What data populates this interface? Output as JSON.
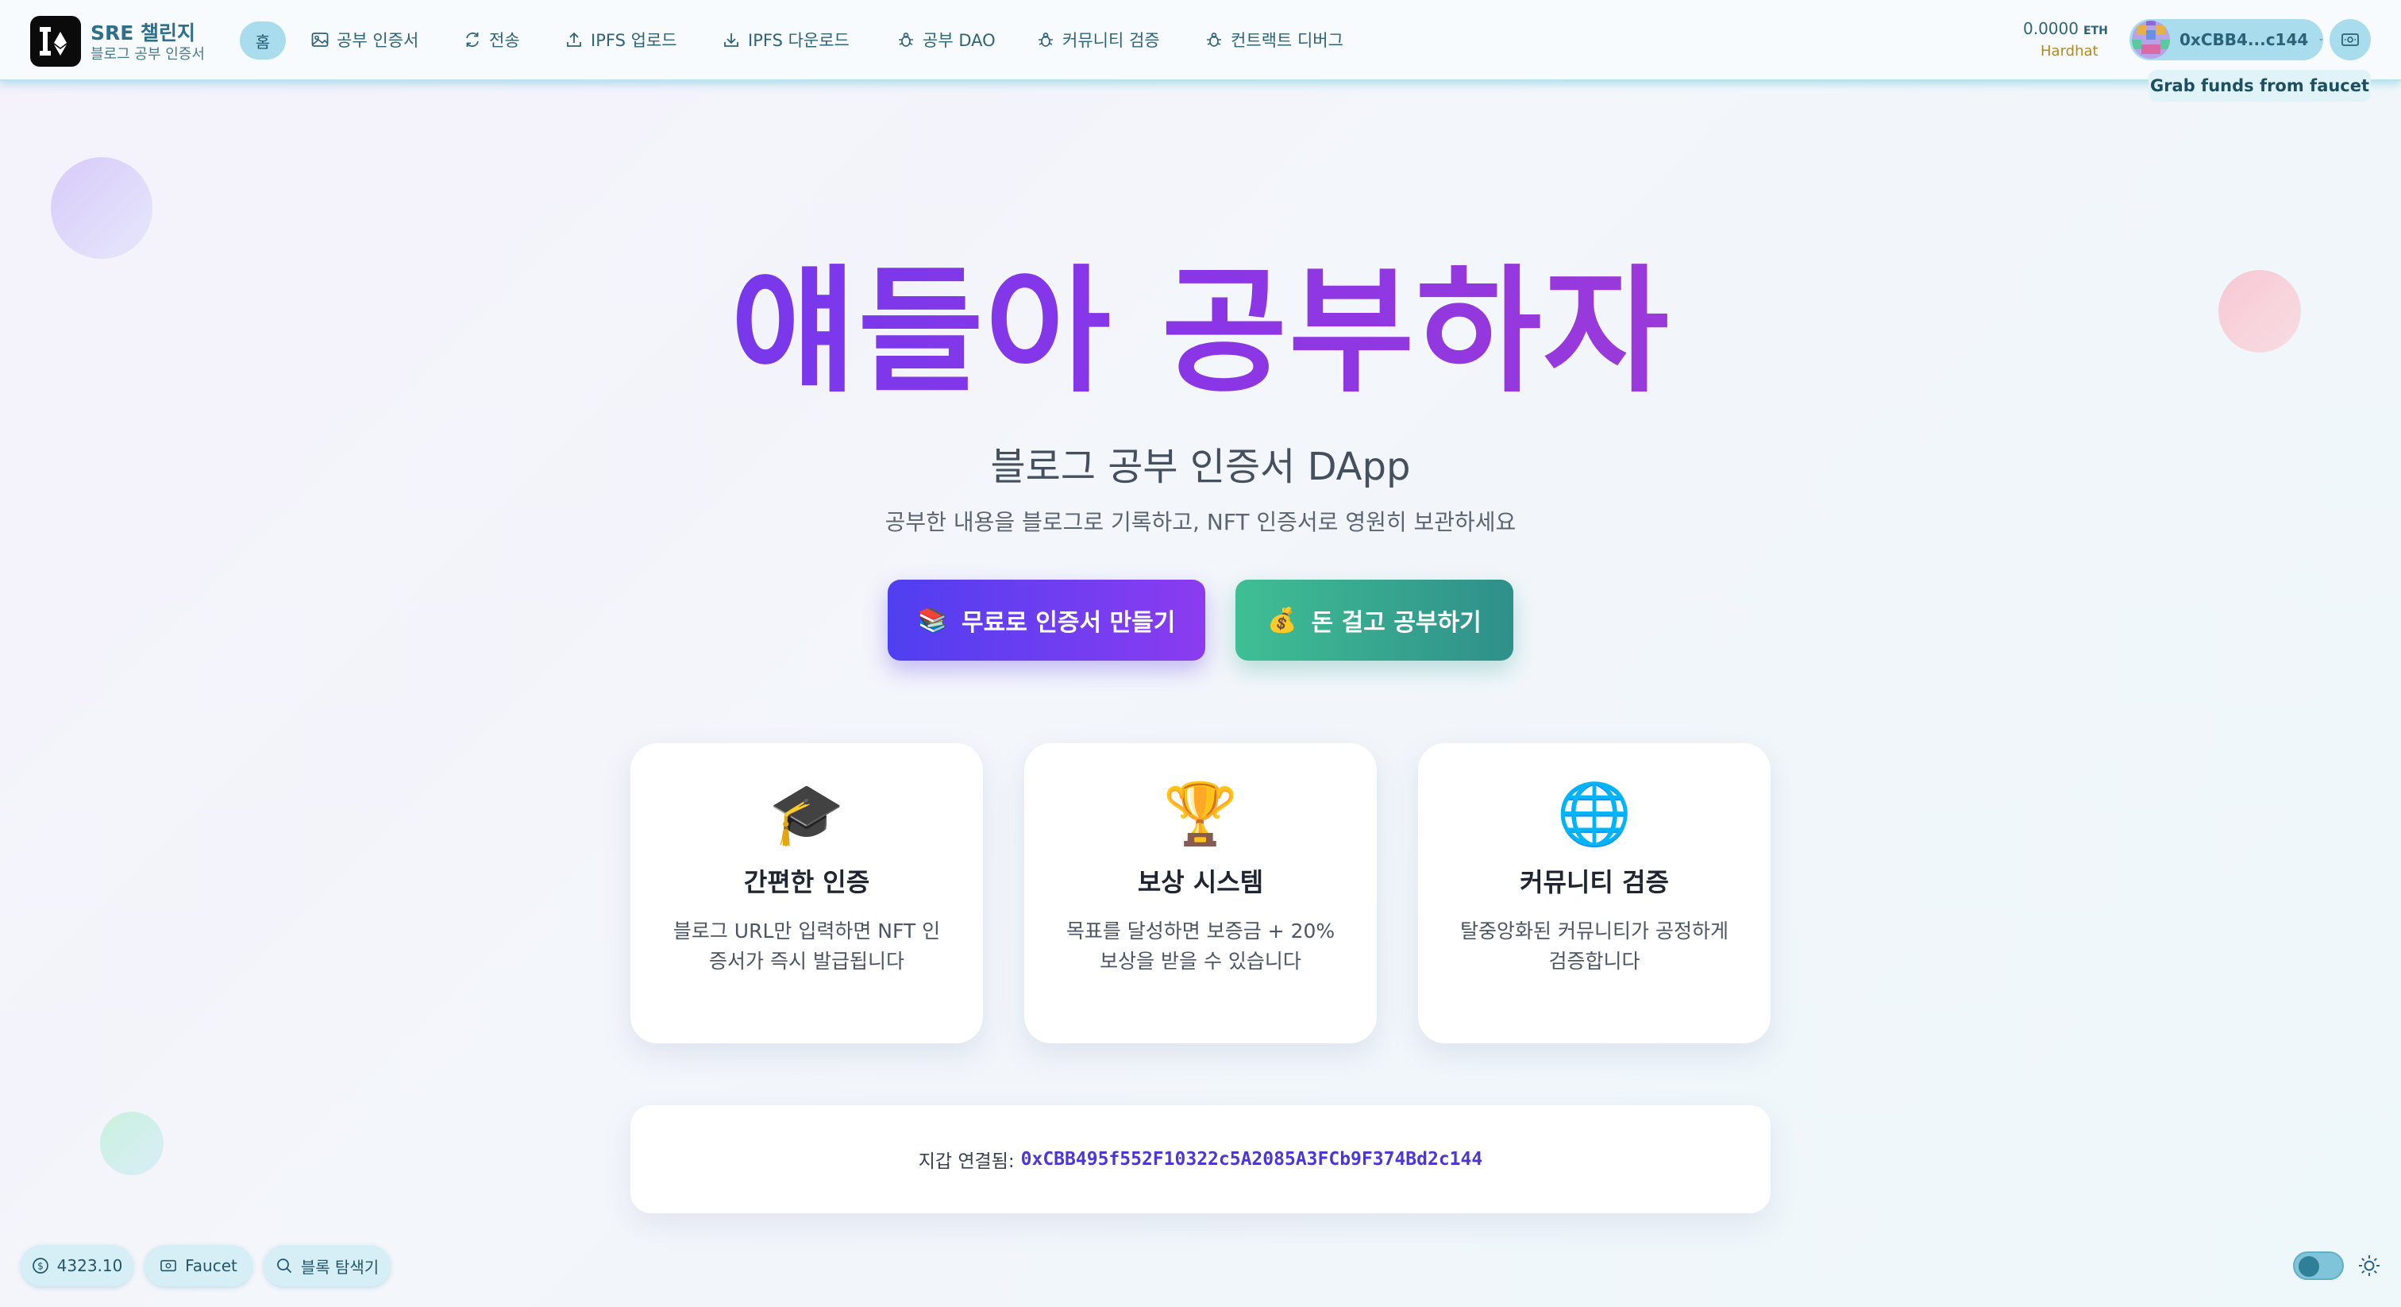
{
  "header": {
    "brand_title": "SRE 챌린지",
    "brand_subtitle": "블로그 공부 인증서",
    "nav": [
      {
        "label": "홈",
        "icon": "home"
      },
      {
        "label": "공부 인증서",
        "icon": "image-icon"
      },
      {
        "label": "전송",
        "icon": "refresh-icon"
      },
      {
        "label": "IPFS 업로드",
        "icon": "upload-icon"
      },
      {
        "label": "IPFS 다운로드",
        "icon": "download-icon"
      },
      {
        "label": "공부 DAO",
        "icon": "bug-icon"
      },
      {
        "label": "커뮤니티 검증",
        "icon": "bug-icon"
      },
      {
        "label": "컨트랙트 디버그",
        "icon": "bug-icon"
      }
    ],
    "balance": "0.0000",
    "balance_unit": "ETH",
    "network": "Hardhat",
    "wallet_short": "0xCBB4...c144",
    "faucet_tooltip": "Grab funds from faucet"
  },
  "hero": {
    "title": "얘들아 공부하자",
    "subtitle": "블로그 공부 인증서 DApp",
    "description": "공부한 내용을 블로그로 기록하고, NFT 인증서로 영원히 보관하세요",
    "primary_button": {
      "emoji": "📚",
      "label": "무료로 인증서 만들기"
    },
    "secondary_button": {
      "emoji": "💰",
      "label": "돈 걸고 공부하기"
    }
  },
  "features": [
    {
      "emoji": "🎓",
      "title": "간편한 인증",
      "text": "블로그 URL만 입력하면 NFT 인증서가 즉시 발급됩니다"
    },
    {
      "emoji": "🏆",
      "title": "보상 시스템",
      "text": "목표를 달성하면 보증금 + 20% 보상을 받을 수 있습니다"
    },
    {
      "emoji": "🌐",
      "title": "커뮤니티 검증",
      "text": "탈중앙화된 커뮤니티가 공정하게 검증합니다"
    }
  ],
  "wallet_box": {
    "label": "지갑 연결됨:",
    "address": "0xCBB495f552F10322c5A2085A3FCb9F374Bd2c144"
  },
  "footer": {
    "price": "4323.10",
    "faucet_label": "Faucet",
    "explorer_label": "블록 탐색기"
  },
  "colors": {
    "accent_purple": "#5b3df2",
    "accent_pink": "#b33fc4",
    "accent_green": "#3fbf94",
    "header_pill": "#a9dcec",
    "network_gold": "#b58a1a"
  }
}
